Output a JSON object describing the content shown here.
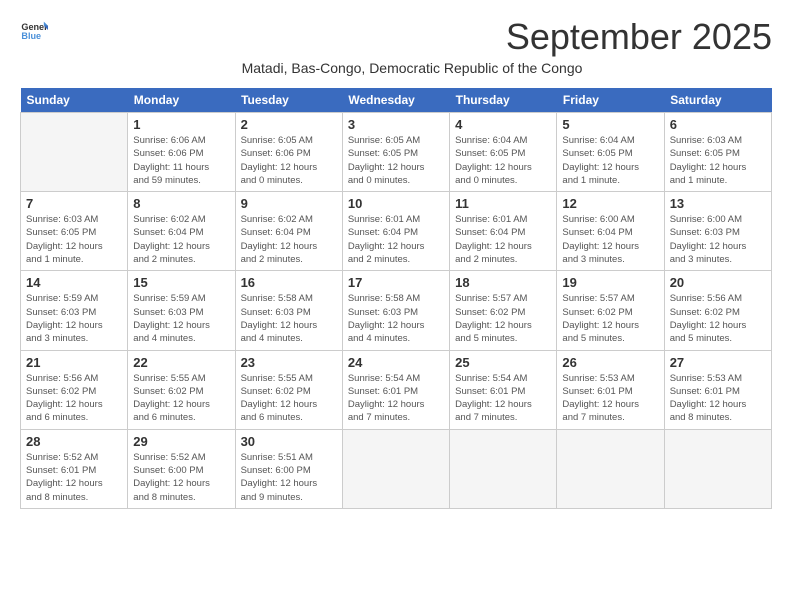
{
  "logo": {
    "general": "General",
    "blue": "Blue"
  },
  "title": "September 2025",
  "subtitle": "Matadi, Bas-Congo, Democratic Republic of the Congo",
  "headers": [
    "Sunday",
    "Monday",
    "Tuesday",
    "Wednesday",
    "Thursday",
    "Friday",
    "Saturday"
  ],
  "weeks": [
    [
      {
        "num": "",
        "info": ""
      },
      {
        "num": "1",
        "info": "Sunrise: 6:06 AM\nSunset: 6:06 PM\nDaylight: 11 hours\nand 59 minutes."
      },
      {
        "num": "2",
        "info": "Sunrise: 6:05 AM\nSunset: 6:06 PM\nDaylight: 12 hours\nand 0 minutes."
      },
      {
        "num": "3",
        "info": "Sunrise: 6:05 AM\nSunset: 6:05 PM\nDaylight: 12 hours\nand 0 minutes."
      },
      {
        "num": "4",
        "info": "Sunrise: 6:04 AM\nSunset: 6:05 PM\nDaylight: 12 hours\nand 0 minutes."
      },
      {
        "num": "5",
        "info": "Sunrise: 6:04 AM\nSunset: 6:05 PM\nDaylight: 12 hours\nand 1 minute."
      },
      {
        "num": "6",
        "info": "Sunrise: 6:03 AM\nSunset: 6:05 PM\nDaylight: 12 hours\nand 1 minute."
      }
    ],
    [
      {
        "num": "7",
        "info": "Sunrise: 6:03 AM\nSunset: 6:05 PM\nDaylight: 12 hours\nand 1 minute."
      },
      {
        "num": "8",
        "info": "Sunrise: 6:02 AM\nSunset: 6:04 PM\nDaylight: 12 hours\nand 2 minutes."
      },
      {
        "num": "9",
        "info": "Sunrise: 6:02 AM\nSunset: 6:04 PM\nDaylight: 12 hours\nand 2 minutes."
      },
      {
        "num": "10",
        "info": "Sunrise: 6:01 AM\nSunset: 6:04 PM\nDaylight: 12 hours\nand 2 minutes."
      },
      {
        "num": "11",
        "info": "Sunrise: 6:01 AM\nSunset: 6:04 PM\nDaylight: 12 hours\nand 2 minutes."
      },
      {
        "num": "12",
        "info": "Sunrise: 6:00 AM\nSunset: 6:04 PM\nDaylight: 12 hours\nand 3 minutes."
      },
      {
        "num": "13",
        "info": "Sunrise: 6:00 AM\nSunset: 6:03 PM\nDaylight: 12 hours\nand 3 minutes."
      }
    ],
    [
      {
        "num": "14",
        "info": "Sunrise: 5:59 AM\nSunset: 6:03 PM\nDaylight: 12 hours\nand 3 minutes."
      },
      {
        "num": "15",
        "info": "Sunrise: 5:59 AM\nSunset: 6:03 PM\nDaylight: 12 hours\nand 4 minutes."
      },
      {
        "num": "16",
        "info": "Sunrise: 5:58 AM\nSunset: 6:03 PM\nDaylight: 12 hours\nand 4 minutes."
      },
      {
        "num": "17",
        "info": "Sunrise: 5:58 AM\nSunset: 6:03 PM\nDaylight: 12 hours\nand 4 minutes."
      },
      {
        "num": "18",
        "info": "Sunrise: 5:57 AM\nSunset: 6:02 PM\nDaylight: 12 hours\nand 5 minutes."
      },
      {
        "num": "19",
        "info": "Sunrise: 5:57 AM\nSunset: 6:02 PM\nDaylight: 12 hours\nand 5 minutes."
      },
      {
        "num": "20",
        "info": "Sunrise: 5:56 AM\nSunset: 6:02 PM\nDaylight: 12 hours\nand 5 minutes."
      }
    ],
    [
      {
        "num": "21",
        "info": "Sunrise: 5:56 AM\nSunset: 6:02 PM\nDaylight: 12 hours\nand 6 minutes."
      },
      {
        "num": "22",
        "info": "Sunrise: 5:55 AM\nSunset: 6:02 PM\nDaylight: 12 hours\nand 6 minutes."
      },
      {
        "num": "23",
        "info": "Sunrise: 5:55 AM\nSunset: 6:02 PM\nDaylight: 12 hours\nand 6 minutes."
      },
      {
        "num": "24",
        "info": "Sunrise: 5:54 AM\nSunset: 6:01 PM\nDaylight: 12 hours\nand 7 minutes."
      },
      {
        "num": "25",
        "info": "Sunrise: 5:54 AM\nSunset: 6:01 PM\nDaylight: 12 hours\nand 7 minutes."
      },
      {
        "num": "26",
        "info": "Sunrise: 5:53 AM\nSunset: 6:01 PM\nDaylight: 12 hours\nand 7 minutes."
      },
      {
        "num": "27",
        "info": "Sunrise: 5:53 AM\nSunset: 6:01 PM\nDaylight: 12 hours\nand 8 minutes."
      }
    ],
    [
      {
        "num": "28",
        "info": "Sunrise: 5:52 AM\nSunset: 6:01 PM\nDaylight: 12 hours\nand 8 minutes."
      },
      {
        "num": "29",
        "info": "Sunrise: 5:52 AM\nSunset: 6:00 PM\nDaylight: 12 hours\nand 8 minutes."
      },
      {
        "num": "30",
        "info": "Sunrise: 5:51 AM\nSunset: 6:00 PM\nDaylight: 12 hours\nand 9 minutes."
      },
      {
        "num": "",
        "info": ""
      },
      {
        "num": "",
        "info": ""
      },
      {
        "num": "",
        "info": ""
      },
      {
        "num": "",
        "info": ""
      }
    ]
  ]
}
